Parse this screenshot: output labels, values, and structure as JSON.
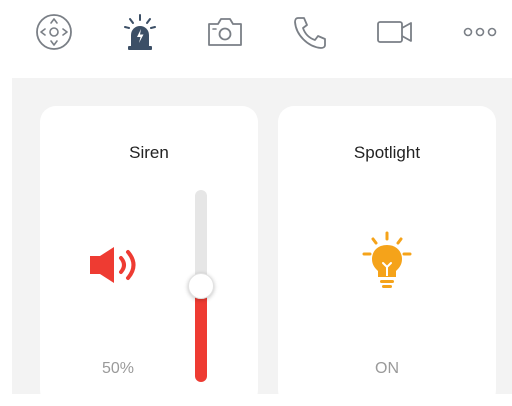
{
  "toolbar": {
    "items": [
      {
        "icon": "directional-pad-icon"
      },
      {
        "icon": "alarm-beacon-icon"
      },
      {
        "icon": "camera-icon"
      },
      {
        "icon": "phone-icon"
      },
      {
        "icon": "video-camera-icon"
      },
      {
        "icon": "more-icon"
      }
    ]
  },
  "siren": {
    "title": "Siren",
    "volume_label": "50%",
    "volume_fraction": 0.5,
    "icon": "speaker-icon",
    "color": "#ee3b32"
  },
  "spotlight": {
    "title": "Spotlight",
    "status": "ON",
    "icon": "lightbulb-icon",
    "color": "#f5a31a"
  },
  "colors": {
    "accent_red": "#ee3b32",
    "accent_orange": "#f5a31a",
    "icon_gray": "#7a7f86",
    "alarm_navy": "#3c4f66"
  }
}
